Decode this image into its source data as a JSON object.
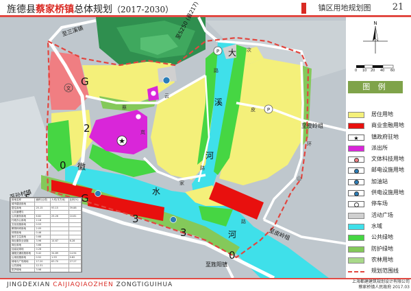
{
  "header": {
    "title_prefix": "旌德县",
    "title_town": "蔡家桥镇",
    "title_suffix": "总体规划",
    "title_years": "（2017-2030）",
    "sheet_name": "镇区用地规划图",
    "page_number": "21"
  },
  "map": {
    "scale_numbers": [
      "0",
      "10",
      "20",
      "40",
      "60"
    ],
    "legend_title": "图 例",
    "legend": [
      {
        "label": "居住用地",
        "color": "#f4f07a",
        "kind": "swatch"
      },
      {
        "label": "商业金融用地",
        "color": "#e8100e",
        "kind": "swatch"
      },
      {
        "label": "镇政府驻地",
        "color": "#d926d9",
        "kind": "star"
      },
      {
        "label": "派出所",
        "color": "#d926d9",
        "kind": "swatch"
      },
      {
        "label": "文体科技用地",
        "color": "#f07e82",
        "kind": "circle"
      },
      {
        "label": "邮电设施用地",
        "color": "#2a7db8",
        "kind": "circle"
      },
      {
        "label": "加油站",
        "color": "#2a7db8",
        "kind": "circle"
      },
      {
        "label": "供电设施用地",
        "color": "#2a7db8",
        "kind": "circle"
      },
      {
        "label": "停车场",
        "color": "#ffffff",
        "kind": "circle"
      },
      {
        "label": "活动广场",
        "color": "#d0d0d0",
        "kind": "swatch"
      },
      {
        "label": "水域",
        "color": "#3fe0ea",
        "kind": "swatch"
      },
      {
        "label": "公共绿地",
        "color": "#46d643",
        "kind": "swatch"
      },
      {
        "label": "防护绿地",
        "color": "#84c95a",
        "kind": "swatch"
      },
      {
        "label": "农林用地",
        "color": "#a9d98a",
        "kind": "swatch"
      },
      {
        "label": "规划范围线",
        "color": "#e2463f",
        "kind": "dashed"
      }
    ],
    "roads": {
      "g205_chars": [
        "G",
        "2",
        "0",
        "5"
      ],
      "g205_chars2": [
        "G",
        "3",
        "3",
        "0"
      ],
      "s250": "至S250 (县217)",
      "s250_left": "至三溪镇",
      "daxi_chars": [
        "大",
        "溪",
        "河"
      ],
      "huishui_chars": [
        "徽",
        "水",
        "河"
      ],
      "ci_road_chars": [
        "次",
        "路"
      ],
      "yun_chars": [
        "云",
        "路"
      ],
      "lan_chars": [
        "蔡",
        "岚",
        "乐"
      ],
      "jia_chars": [
        "家",
        "路"
      ],
      "pi_chars": [
        "皮",
        "路"
      ],
      "huan_chars": [
        "环",
        "山",
        "路"
      ],
      "to_piling_1": "至皮岭组",
      "to_piling_2": "至皮岭组",
      "to_sunchun": "至孙村镇",
      "to_jingyang": "至旌阳镇"
    },
    "stats_table": {
      "headers": [
        "用地名称",
        "面积(公顷)",
        "人均(平方米)",
        "比例(%)"
      ],
      "rows": [
        [
          "城市建设用地",
          "",
          "",
          ""
        ],
        [
          "居住用地",
          "25.15",
          "93.15",
          "39.88"
        ],
        [
          "公共管理与",
          "",
          "",
          ""
        ],
        [
          "公共服务用地",
          "6.82",
          "25.26",
          "10.81"
        ],
        [
          "行政办公用地",
          "2.18",
          "",
          ""
        ],
        [
          "文化设施用地",
          "0.53",
          "",
          ""
        ],
        [
          "教育科研用地",
          "2.05",
          "",
          ""
        ],
        [
          "体育用地",
          "0.46",
          "",
          ""
        ],
        [
          "医疗卫生用地",
          "0.68",
          "",
          ""
        ],
        [
          "商业服务业设施",
          "3.96",
          "14.67",
          "6.28"
        ],
        [
          "商业用地",
          "3.68",
          "",
          ""
        ],
        [
          "加油站用地",
          "0.28",
          "",
          ""
        ],
        [
          "道路交通设施用地",
          "9.42",
          "34.89",
          "14.94"
        ],
        [
          "公用设施用地",
          "0.52",
          "1.93",
          "0.82"
        ],
        [
          "绿地与广场用地",
          "17.20",
          "63.70",
          "27.27"
        ],
        [
          "公共绿地",
          "12.31",
          "",
          ""
        ],
        [
          "防护绿地",
          "3.98",
          "",
          ""
        ],
        [
          "广场用地",
          "0.91",
          "",
          ""
        ],
        [
          "合计",
          "63.07",
          "233.59",
          "100.00"
        ]
      ]
    }
  },
  "footer": {
    "pinyin_1": "JINGDEXIAN",
    "pinyin_2": "CAIJIAQIAOZHEN",
    "pinyin_3": "ZONGTIGUIHUA",
    "org_line1": "上海都建建筑规划设计有限公司",
    "org_line2": "蔡家桥镇人民政府  2017.03"
  }
}
